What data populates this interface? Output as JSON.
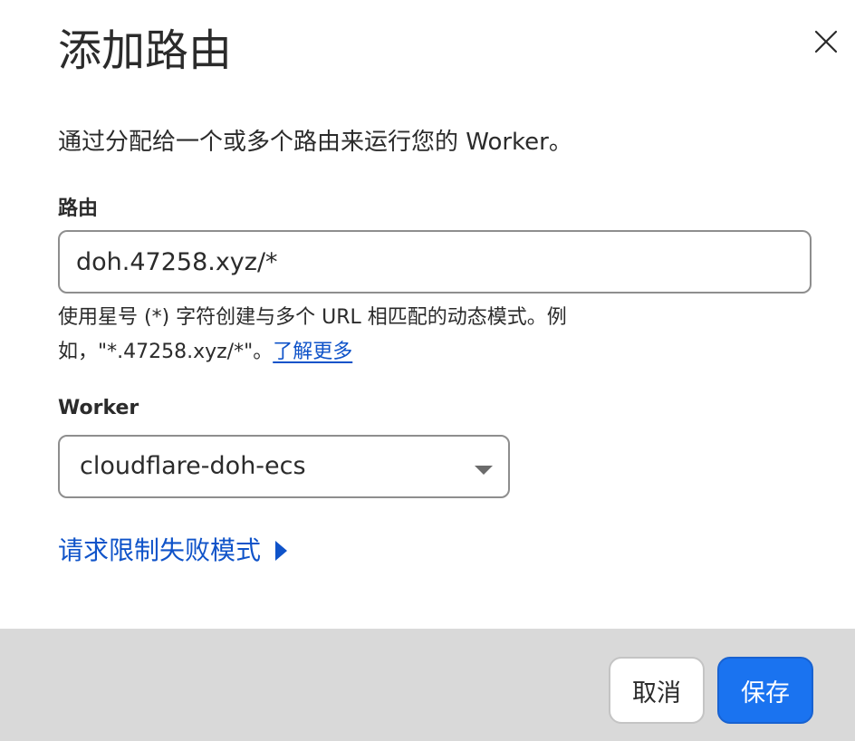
{
  "dialog": {
    "title": "添加路由",
    "description": "通过分配给一个或多个路由来运行您的 Worker。",
    "close_icon": "close-icon"
  },
  "route": {
    "label": "路由",
    "value": "doh.47258.xyz/*",
    "hint_line1": "使用星号 (*) 字符创建与多个 URL 相匹配的动态模式。例",
    "hint_line2": "如，\"*.47258.xyz/*\"。",
    "learn_more": "了解更多"
  },
  "worker": {
    "label": "Worker",
    "selected": "cloudflare-doh-ecs",
    "caret_icon": "caret-down-icon"
  },
  "advanced": {
    "label": "请求限制失败模式",
    "icon": "triangle-right-icon"
  },
  "footer": {
    "cancel_label": "取消",
    "save_label": "保存"
  },
  "colors": {
    "link": "#0f53c9",
    "primary": "#1a73f0",
    "footer_bg": "#d9d9d9"
  }
}
